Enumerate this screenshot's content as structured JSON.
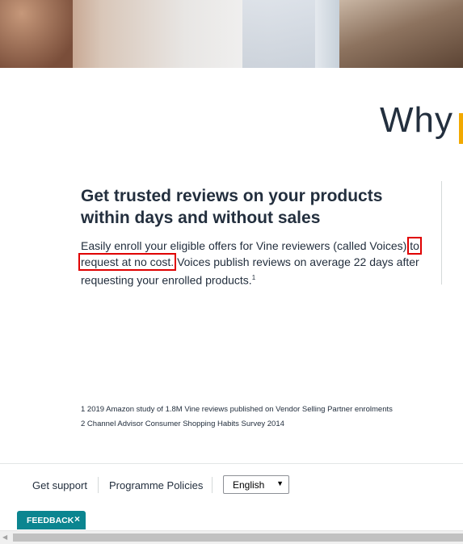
{
  "hero": {
    "image_alt": "hero-photo"
  },
  "section": {
    "heading_partial": "Why",
    "headline": "Get trusted reviews on your products within days and without sales",
    "body_pre": "Easily enroll your eligible offers for Vine reviewers (called Voices) ",
    "body_highlight": "to request at no cost.",
    "body_post": " Voices publish reviews on average 22 days after requesting your enrolled products.",
    "body_sup": "1"
  },
  "footnotes": [
    "1 2019 Amazon study of 1.8M Vine reviews published on Vendor Selling Partner enrolments",
    "2 Channel Advisor Consumer Shopping Habits Survey 2014"
  ],
  "footer": {
    "get_support": "Get support",
    "programme_policies": "Programme Policies",
    "language_selected": "English",
    "language_caret": "▼"
  },
  "feedback": {
    "label": "FEEDBACK",
    "close": "×"
  },
  "scrollbar": {
    "left_arrow": "◀"
  }
}
